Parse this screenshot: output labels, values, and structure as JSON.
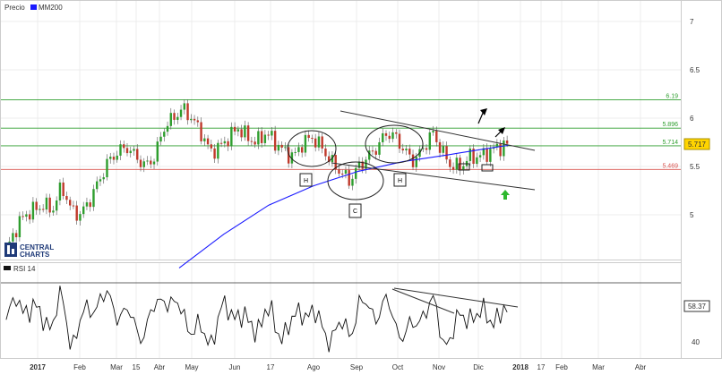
{
  "legend": {
    "price_label": "Precio",
    "ma_label": "MM200",
    "ma_color": "#1a1aff",
    "rsi_label": "RSI 14"
  },
  "logo": {
    "line1": "CENTRAL",
    "line2": "CHARTS"
  },
  "colors": {
    "up_candle": "#2e9e2e",
    "down_candle": "#c0392b",
    "level_green": "#2e9e2e",
    "level_red": "#d9534f",
    "ma": "#1a1aff",
    "trend": "#333333",
    "badge_bg": "#ffd400",
    "signal_arrow": "#2eb82e"
  },
  "chart_data": [
    {
      "type": "candlestick",
      "title": "",
      "ylim": [
        4.45,
        7.2
      ],
      "y_ticks": [
        "7",
        "6.5",
        "6",
        "5.5",
        "5"
      ],
      "y_tick_values": [
        7,
        6.5,
        6,
        5.5,
        5
      ],
      "x_tick_labels": [
        "2017",
        "Feb",
        "Mar",
        "15",
        "Abr",
        "May",
        "Jun",
        "17",
        "Ago",
        "Sep",
        "Oct",
        "Nov",
        "Dic",
        "2018",
        "17",
        "Feb",
        "Mar",
        "Abr"
      ],
      "levels": [
        {
          "label": "6.19",
          "value": 6.19,
          "color": "green"
        },
        {
          "label": "5.896",
          "value": 5.896,
          "color": "green"
        },
        {
          "label": "5.714",
          "value": 5.714,
          "color": "green"
        },
        {
          "label": "5.469",
          "value": 5.469,
          "color": "red"
        }
      ],
      "last_price": "5.717",
      "series": [
        {
          "name": "Precio",
          "approx_closes": [
            4.62,
            4.85,
            5.0,
            5.05,
            5.1,
            5.05,
            5.3,
            5.05,
            5.0,
            5.15,
            5.35,
            5.55,
            5.65,
            5.7,
            5.6,
            5.5,
            5.6,
            5.9,
            6.0,
            6.1,
            6.0,
            5.85,
            5.65,
            5.7,
            5.8,
            5.9,
            5.8,
            5.75,
            5.85,
            5.75,
            5.65,
            5.6,
            5.75,
            5.8,
            5.7,
            5.55,
            5.45,
            5.35,
            5.5,
            5.6,
            5.7,
            5.85,
            5.8,
            5.65,
            5.55,
            5.7,
            5.85,
            5.65,
            5.5,
            5.5,
            5.6,
            5.6,
            5.65,
            5.7,
            5.72
          ]
        },
        {
          "name": "MM200",
          "approx_values": [
            4.45,
            4.8,
            5.1,
            5.3,
            5.45,
            5.55,
            5.62,
            5.68,
            5.72
          ]
        }
      ],
      "annotations": [
        "H",
        "C",
        "H"
      ]
    },
    {
      "type": "line",
      "title": "",
      "series_name": "RSI 14",
      "y_ticks": [
        "40"
      ],
      "y_tick_values": [
        40
      ],
      "last_value": "58.37",
      "ylim": [
        30,
        80
      ]
    }
  ]
}
